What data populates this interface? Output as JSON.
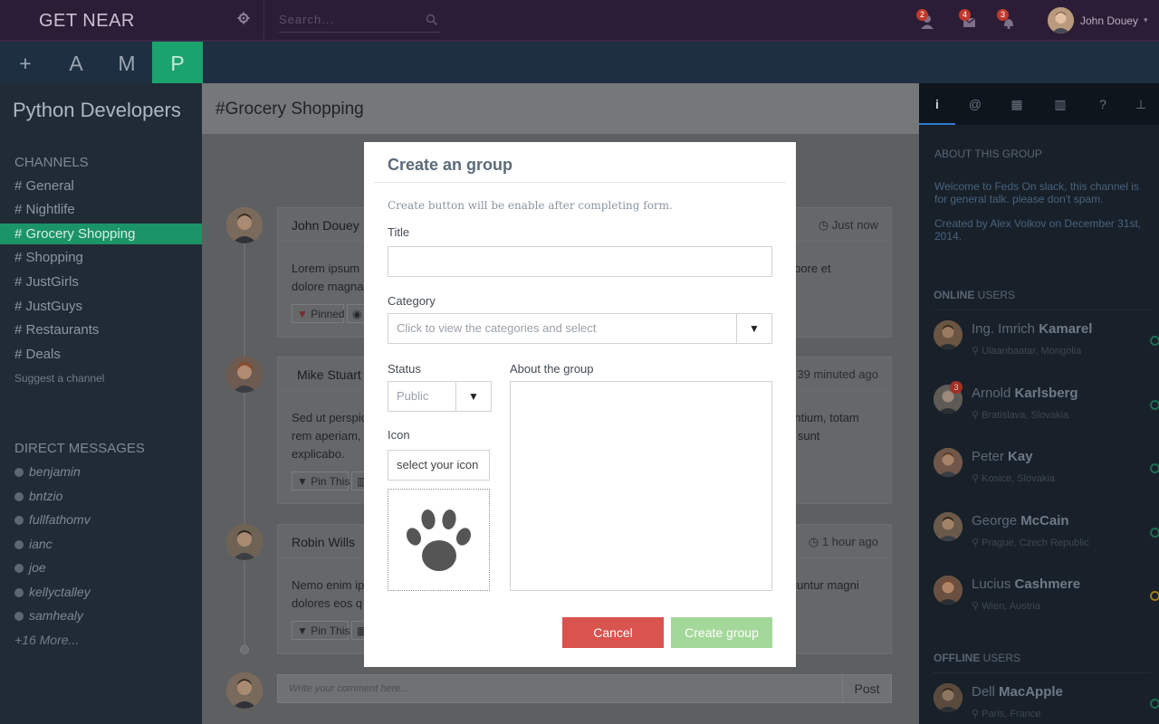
{
  "topbar": {
    "brand": "GET NEAR",
    "search_placeholder": "Search...",
    "notifications": [
      {
        "icon": "user-add-icon",
        "count": "2"
      },
      {
        "icon": "envelope-icon",
        "count": "4"
      },
      {
        "icon": "bell-icon",
        "count": "3"
      }
    ],
    "user_name": "John Douey"
  },
  "appbar": {
    "items": [
      {
        "label": "+"
      },
      {
        "label": "A"
      },
      {
        "label": "M"
      },
      {
        "label": "P"
      }
    ],
    "active_color": "#1aa36f"
  },
  "sidebar": {
    "team_name": "Python Developers",
    "channels_title": "CHANNELS",
    "channels": [
      {
        "label": "# General"
      },
      {
        "label": "# Nightlife"
      },
      {
        "label": "# Grocery Shopping"
      },
      {
        "label": "# Shopping"
      },
      {
        "label": "# JustGirls"
      },
      {
        "label": "# JustGuys"
      },
      {
        "label": "# Restaurants"
      },
      {
        "label": "# Deals"
      }
    ],
    "suggest": "Suggest a channel",
    "dm_title": "DIRECT MESSAGES",
    "direct_messages": [
      {
        "label": "benjamin"
      },
      {
        "label": "bntzio"
      },
      {
        "label": "fullfathomv"
      },
      {
        "label": "ianc"
      },
      {
        "label": "joe"
      },
      {
        "label": "kellyctalley"
      },
      {
        "label": "samhealy"
      }
    ],
    "more": "+16 More..."
  },
  "main": {
    "title": "#Grocery Shopping",
    "posts": [
      {
        "author": "John Douey",
        "time": "Just now",
        "body_left": "Lorem ipsum",
        "body_right": "labore et",
        "body_line2": "dolore magna",
        "buttons": [
          "Pinned",
          ""
        ]
      },
      {
        "author": "Mike Stuart",
        "time": "39 minuted ago",
        "body_left": "Sed ut perspic",
        "body_right": "antium, totam",
        "body_line2": "rem aperiam,",
        "body_right2": "n sunt",
        "body_line3": "explicabo.",
        "buttons": [
          "Pin This",
          ""
        ]
      },
      {
        "author": "Robin Wills",
        "time": "1 hour ago",
        "body_left": "Nemo enim ip",
        "body_right": "luuntur magni",
        "body_line2": "dolores eos q",
        "buttons": [
          "Pin This",
          ""
        ]
      }
    ],
    "comment_placeholder": "Write your comment here...",
    "post_button": "Post"
  },
  "rpanel": {
    "tabs": [
      {
        "icon": "info-icon",
        "glyph": "i"
      },
      {
        "icon": "at-icon",
        "glyph": "@"
      },
      {
        "icon": "calendar-icon",
        "glyph": "▦"
      },
      {
        "icon": "chart-icon",
        "glyph": "▥"
      },
      {
        "icon": "question-icon",
        "glyph": "?"
      },
      {
        "icon": "pin-icon",
        "glyph": "⊥"
      }
    ],
    "about_title": "ABOUT THIS GROUP",
    "about_text": "Welcome to Feds On slack, this channel is for general talk. please don't spam.",
    "created_text": "Created by Alex Volkov on December 31st, 2014.",
    "online_title_bold": "ONLINE",
    "online_title_rest": " USERS",
    "online_users": [
      {
        "first": "Ing. Imrich ",
        "last": "Kamarel",
        "location": "Ulaanbaatar, Mongolia",
        "status": "online"
      },
      {
        "first": "Arnold ",
        "last": "Karlsberg",
        "location": "Bratislava, Slovakia",
        "status": "online",
        "badge": "3"
      },
      {
        "first": "Peter ",
        "last": "Kay",
        "location": "Kosice, Slovakia",
        "status": "online"
      },
      {
        "first": "George ",
        "last": "McCain",
        "location": "Prague, Czech Republic",
        "status": "online"
      },
      {
        "first": "Lucius ",
        "last": "Cashmere",
        "location": "Wien, Austria",
        "status": "away"
      }
    ],
    "offline_title_bold": "OFFLINE",
    "offline_title_rest": " USERS",
    "offline_users": [
      {
        "first": "Dell ",
        "last": "MacApple",
        "location": "Paris, France",
        "status": "offline"
      }
    ]
  },
  "modal": {
    "title": "Create an group",
    "note": "Create button will be enable after completing form.",
    "title_label": "Title",
    "title_value": "",
    "category_label": "Category",
    "category_placeholder": "Click to view the categories and select",
    "status_label": "Status",
    "status_value": "Public",
    "about_label": "About the group",
    "about_value": "",
    "icon_label": "Icon",
    "icon_value": "select your icon",
    "icon_preview": "paw-icon",
    "cancel_label": "Cancel",
    "create_label": "Create group",
    "colors": {
      "cancel": "#d9534f",
      "create": "#a4d89a"
    }
  }
}
